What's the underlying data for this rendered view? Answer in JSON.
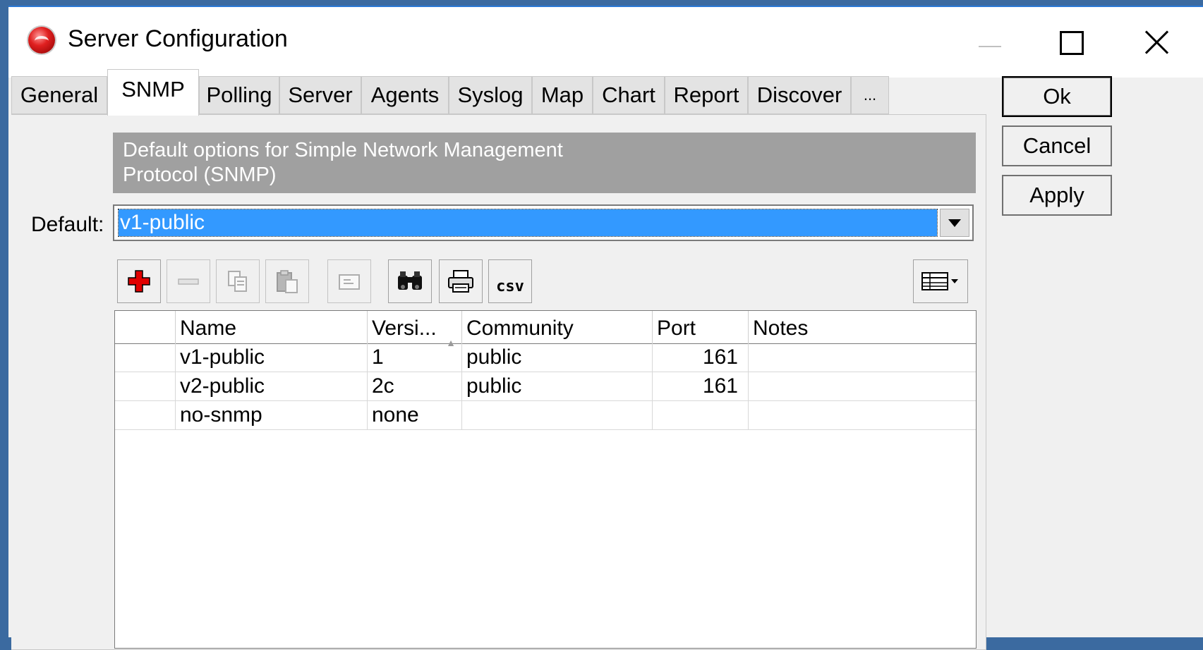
{
  "window": {
    "title": "Server Configuration"
  },
  "tabs": [
    "General",
    "SNMP",
    "Polling",
    "Server",
    "Agents",
    "Syslog",
    "Map",
    "Chart",
    "Report",
    "Discover",
    "..."
  ],
  "active_tab": "SNMP",
  "description": {
    "line1": "Default options for Simple Network Management",
    "line2": "Protocol (SNMP)"
  },
  "default_field": {
    "label": "Default:",
    "value": "v1-public"
  },
  "toolbar": {
    "buttons": [
      "add-icon",
      "remove-icon",
      "copy-icon",
      "paste-icon",
      "edit-icon",
      "find-icon",
      "print-icon",
      "csv-icon",
      "columns-icon"
    ],
    "csv_label": "csv"
  },
  "table": {
    "columns": [
      "Name",
      "Versi...",
      "Community",
      "Port",
      "Notes"
    ],
    "rows": [
      {
        "name": "v1-public",
        "version": "1",
        "community": "public",
        "port": "161",
        "notes": ""
      },
      {
        "name": "v2-public",
        "version": "2c",
        "community": "public",
        "port": "161",
        "notes": ""
      },
      {
        "name": "no-snmp",
        "version": "none",
        "community": "",
        "port": "",
        "notes": ""
      }
    ]
  },
  "buttons": {
    "ok": "Ok",
    "cancel": "Cancel",
    "apply": "Apply"
  },
  "colors": {
    "selection": "#3399ff",
    "banner": "#a0a0a0",
    "accent": "#2b79d6"
  }
}
